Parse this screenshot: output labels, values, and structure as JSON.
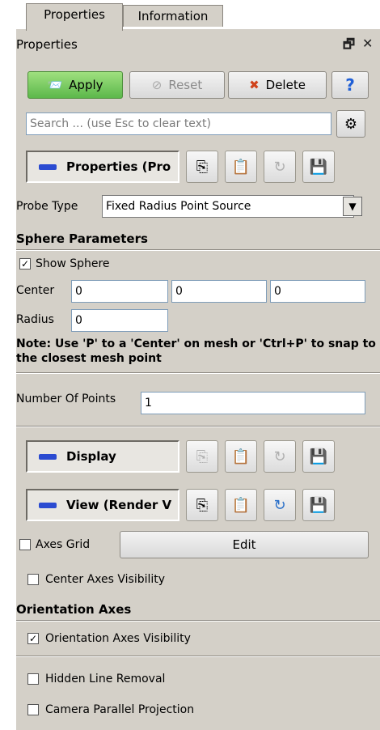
{
  "tabs": [
    {
      "label": "Properties"
    },
    {
      "label": "Information"
    }
  ],
  "panel": {
    "title": "Properties",
    "float_icon": "float-window-icon",
    "close_icon": "close-icon"
  },
  "toolbar": {
    "apply_label": "Apply",
    "reset_label": "Reset",
    "delete_label": "Delete",
    "help_glyph": "?"
  },
  "search": {
    "placeholder": "Search ... (use Esc to clear text)",
    "settings_icon": "gear-icon"
  },
  "properties_group": {
    "label": "Properties (Pro"
  },
  "probe": {
    "label": "Probe Type",
    "value": "Fixed Radius Point Source"
  },
  "sphere": {
    "section_title": "Sphere Parameters",
    "show_sphere_label": "Show Sphere",
    "show_sphere_checked": true,
    "center_label": "Center",
    "center_values": [
      "0",
      "0",
      "0"
    ],
    "radius_label": "Radius",
    "radius_value": "0",
    "note": "Note: Use 'P' to a 'Center' on mesh or 'Ctrl+P' to snap to the closest mesh point"
  },
  "points": {
    "label": "Number Of Points",
    "value": "1"
  },
  "display_group": {
    "label": "Display"
  },
  "view_group": {
    "label": "View (Render V"
  },
  "view": {
    "axes_grid_label": "Axes Grid",
    "axes_grid_checked": false,
    "edit_label": "Edit",
    "center_axes_label": "Center Axes Visibility",
    "center_axes_checked": false,
    "orientation_title": "Orientation Axes",
    "orientation_visibility_label": "Orientation Axes Visibility",
    "orientation_visibility_checked": true,
    "hidden_line_label": "Hidden Line Removal",
    "hidden_line_checked": false,
    "camera_parallel_label": "Camera Parallel Projection",
    "camera_parallel_checked": false
  },
  "colors": {
    "panel_bg": "#d4d0c8",
    "apply_green": "#5cb84b",
    "group_accent": "#2b4bd1"
  }
}
